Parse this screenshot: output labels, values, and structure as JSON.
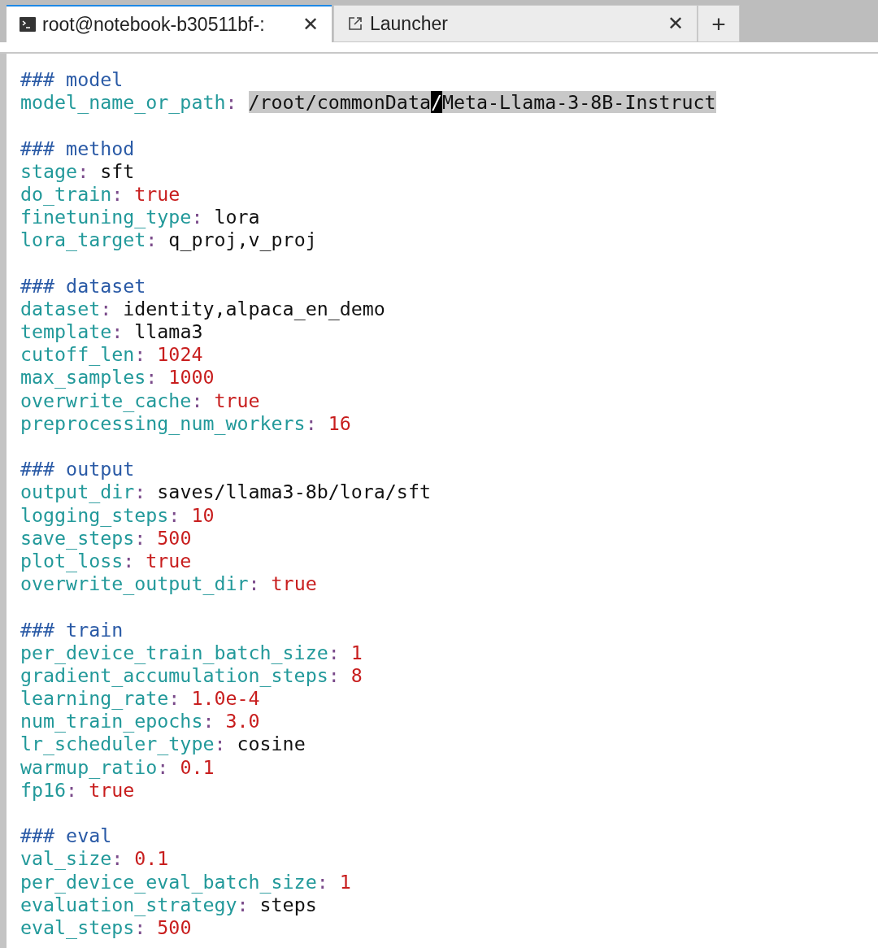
{
  "tabs": [
    {
      "label": "root@notebook-b30511bf-:",
      "selected": true,
      "close": "✕"
    },
    {
      "label": "Launcher",
      "selected": false,
      "close": "✕"
    }
  ],
  "new_tab": "+",
  "lines": [
    {
      "kind": "comment",
      "text": "### model"
    },
    {
      "kind": "pair",
      "key": "model_name_or_path",
      "sep": ":",
      "segments": [
        {
          "text": "/root/commonData",
          "kind": "selected"
        },
        {
          "text": "/",
          "kind": "cursor"
        },
        {
          "text": "Meta-Llama-3-8B-Instruct",
          "kind": "selected"
        }
      ]
    },
    {
      "kind": "blank"
    },
    {
      "kind": "comment",
      "text": "### method"
    },
    {
      "kind": "pair",
      "key": "stage",
      "sep": ":",
      "segments": [
        {
          "text": "sft",
          "kind": "string"
        }
      ]
    },
    {
      "kind": "pair",
      "key": "do_train",
      "sep": ":",
      "segments": [
        {
          "text": "true",
          "kind": "literal"
        }
      ]
    },
    {
      "kind": "pair",
      "key": "finetuning_type",
      "sep": ":",
      "segments": [
        {
          "text": "lora",
          "kind": "string"
        }
      ]
    },
    {
      "kind": "pair",
      "key": "lora_target",
      "sep": ":",
      "segments": [
        {
          "text": "q_proj,v_proj",
          "kind": "string"
        }
      ]
    },
    {
      "kind": "blank"
    },
    {
      "kind": "comment",
      "text": "### dataset"
    },
    {
      "kind": "pair",
      "key": "dataset",
      "sep": ":",
      "segments": [
        {
          "text": "identity,alpaca_en_demo",
          "kind": "string"
        }
      ]
    },
    {
      "kind": "pair",
      "key": "template",
      "sep": ":",
      "segments": [
        {
          "text": "llama3",
          "kind": "string"
        }
      ]
    },
    {
      "kind": "pair",
      "key": "cutoff_len",
      "sep": ":",
      "segments": [
        {
          "text": "1024",
          "kind": "literal"
        }
      ]
    },
    {
      "kind": "pair",
      "key": "max_samples",
      "sep": ":",
      "segments": [
        {
          "text": "1000",
          "kind": "literal"
        }
      ]
    },
    {
      "kind": "pair",
      "key": "overwrite_cache",
      "sep": ":",
      "segments": [
        {
          "text": "true",
          "kind": "literal"
        }
      ]
    },
    {
      "kind": "pair",
      "key": "preprocessing_num_workers",
      "sep": ":",
      "segments": [
        {
          "text": "16",
          "kind": "literal"
        }
      ]
    },
    {
      "kind": "blank"
    },
    {
      "kind": "comment",
      "text": "### output"
    },
    {
      "kind": "pair",
      "key": "output_dir",
      "sep": ":",
      "segments": [
        {
          "text": "saves/llama3-8b/lora/sft",
          "kind": "string"
        }
      ]
    },
    {
      "kind": "pair",
      "key": "logging_steps",
      "sep": ":",
      "segments": [
        {
          "text": "10",
          "kind": "literal"
        }
      ]
    },
    {
      "kind": "pair",
      "key": "save_steps",
      "sep": ":",
      "segments": [
        {
          "text": "500",
          "kind": "literal"
        }
      ]
    },
    {
      "kind": "pair",
      "key": "plot_loss",
      "sep": ":",
      "segments": [
        {
          "text": "true",
          "kind": "literal"
        }
      ]
    },
    {
      "kind": "pair",
      "key": "overwrite_output_dir",
      "sep": ":",
      "segments": [
        {
          "text": "true",
          "kind": "literal"
        }
      ]
    },
    {
      "kind": "blank"
    },
    {
      "kind": "comment",
      "text": "### train"
    },
    {
      "kind": "pair",
      "key": "per_device_train_batch_size",
      "sep": ":",
      "segments": [
        {
          "text": "1",
          "kind": "literal"
        }
      ]
    },
    {
      "kind": "pair",
      "key": "gradient_accumulation_steps",
      "sep": ":",
      "segments": [
        {
          "text": "8",
          "kind": "literal"
        }
      ]
    },
    {
      "kind": "pair",
      "key": "learning_rate",
      "sep": ":",
      "segments": [
        {
          "text": "1.0e-4",
          "kind": "literal"
        }
      ]
    },
    {
      "kind": "pair",
      "key": "num_train_epochs",
      "sep": ":",
      "segments": [
        {
          "text": "3.0",
          "kind": "literal"
        }
      ]
    },
    {
      "kind": "pair",
      "key": "lr_scheduler_type",
      "sep": ":",
      "segments": [
        {
          "text": "cosine",
          "kind": "string"
        }
      ]
    },
    {
      "kind": "pair",
      "key": "warmup_ratio",
      "sep": ":",
      "segments": [
        {
          "text": "0.1",
          "kind": "literal"
        }
      ]
    },
    {
      "kind": "pair",
      "key": "fp16",
      "sep": ":",
      "segments": [
        {
          "text": "true",
          "kind": "literal"
        }
      ]
    },
    {
      "kind": "blank"
    },
    {
      "kind": "comment",
      "text": "### eval"
    },
    {
      "kind": "pair",
      "key": "val_size",
      "sep": ":",
      "segments": [
        {
          "text": "0.1",
          "kind": "literal"
        }
      ]
    },
    {
      "kind": "pair",
      "key": "per_device_eval_batch_size",
      "sep": ":",
      "segments": [
        {
          "text": "1",
          "kind": "literal"
        }
      ]
    },
    {
      "kind": "pair",
      "key": "evaluation_strategy",
      "sep": ":",
      "segments": [
        {
          "text": "steps",
          "kind": "string"
        }
      ]
    },
    {
      "kind": "pair",
      "key": "eval_steps",
      "sep": ":",
      "segments": [
        {
          "text": "500",
          "kind": "literal"
        }
      ]
    }
  ]
}
